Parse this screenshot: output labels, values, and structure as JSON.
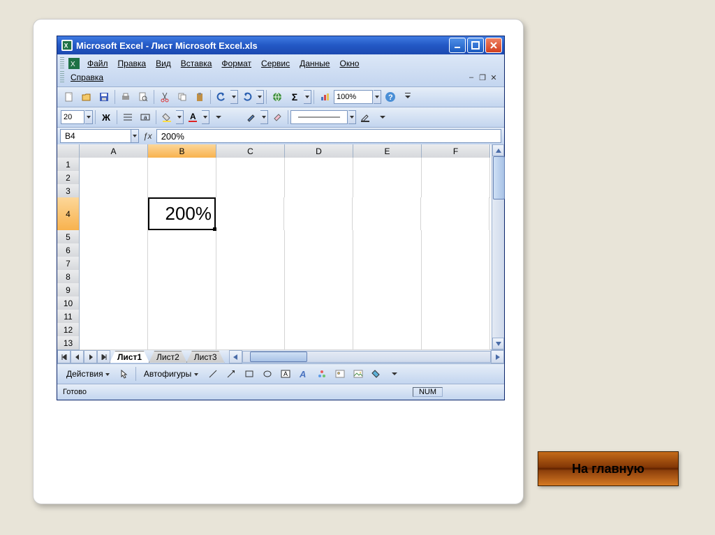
{
  "window": {
    "title": "Microsoft Excel - Лист Microsoft Excel.xls"
  },
  "menu": {
    "file": "Файл",
    "edit": "Правка",
    "view": "Вид",
    "insert": "Вставка",
    "format": "Формат",
    "service": "Сервис",
    "data": "Данные",
    "window": "Окно",
    "help": "Справка"
  },
  "toolbar": {
    "zoom": "100%",
    "fontsize": "20"
  },
  "formula": {
    "namebox": "B4",
    "value": "200%"
  },
  "grid": {
    "cols": [
      "A",
      "B",
      "C",
      "D",
      "E",
      "F"
    ],
    "rows": [
      "1",
      "2",
      "3",
      "4",
      "5",
      "6",
      "7",
      "8",
      "9",
      "10",
      "11",
      "12",
      "13"
    ],
    "active_col": "B",
    "active_row": "4",
    "cell_value": "200%"
  },
  "tabs": {
    "t1": "Лист1",
    "t2": "Лист2",
    "t3": "Лист3"
  },
  "drawbar": {
    "actions": "Действия",
    "autoshapes": "Автофигуры"
  },
  "status": {
    "ready": "Готово",
    "num": "NUM"
  },
  "home_button": "На главную"
}
